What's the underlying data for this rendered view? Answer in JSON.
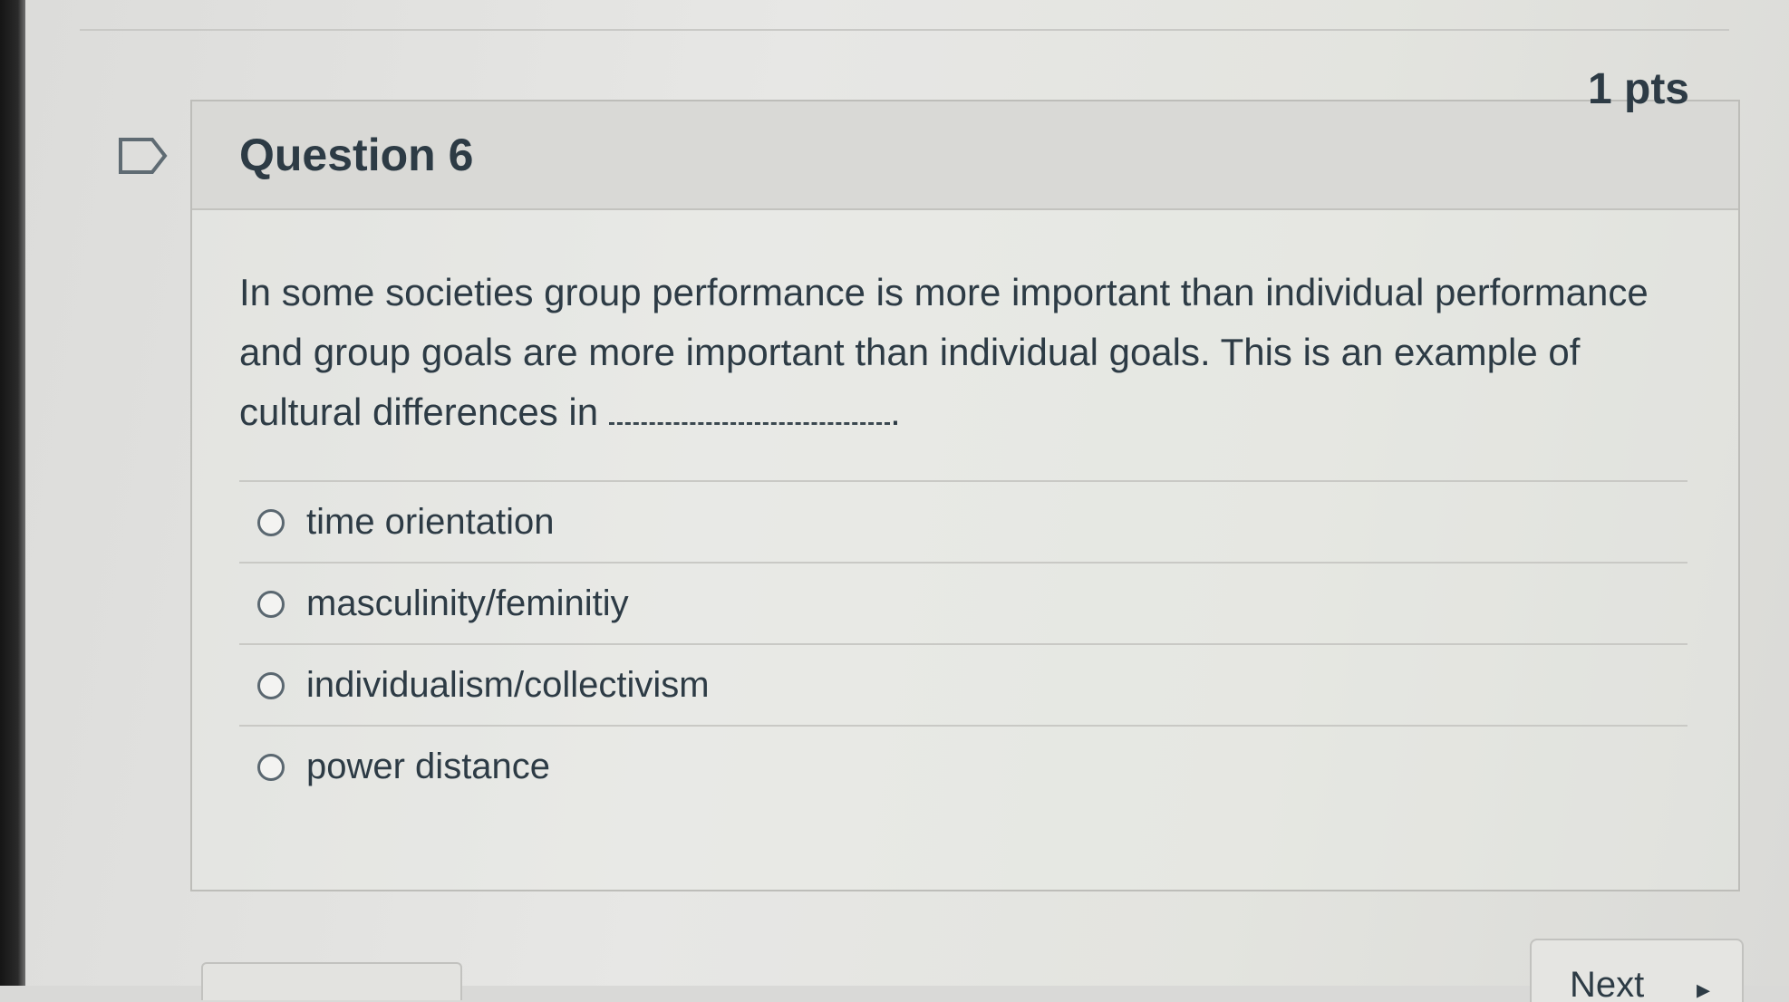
{
  "question": {
    "title": "Question 6",
    "points": "1 pts",
    "text": "In some societies group performance is more important than individual performance and group goals are more important than individual goals. This is an example of cultural differences in",
    "blank_suffix": "."
  },
  "answers": [
    {
      "label": "time orientation",
      "selected": false
    },
    {
      "label": "masculinity/feminitiy",
      "selected": false
    },
    {
      "label": "individualism/collectivism",
      "selected": false
    },
    {
      "label": "power distance",
      "selected": false
    }
  ],
  "navigation": {
    "next_label": "Next",
    "next_icon": "chevron-right-icon"
  },
  "colors": {
    "text": "#2d3b45",
    "header_bg": "#d9d9d6",
    "border": "#bdbdb9"
  }
}
